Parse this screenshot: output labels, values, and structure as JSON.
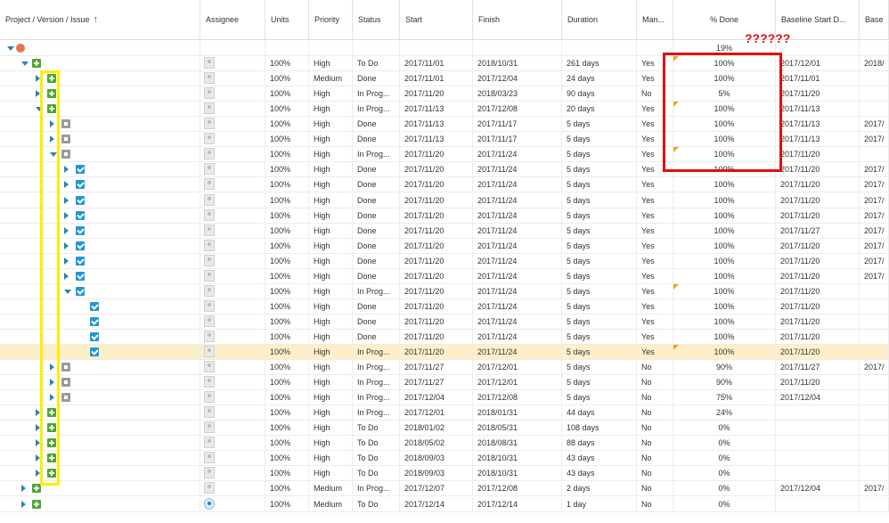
{
  "columns": [
    {
      "key": "tree",
      "label": "Project / Version / Issue"
    },
    {
      "key": "assignee",
      "label": "Assignee"
    },
    {
      "key": "units",
      "label": "Units"
    },
    {
      "key": "priority",
      "label": "Priority"
    },
    {
      "key": "status",
      "label": "Status"
    },
    {
      "key": "start",
      "label": "Start"
    },
    {
      "key": "finish",
      "label": "Finish"
    },
    {
      "key": "duration",
      "label": "Duration"
    },
    {
      "key": "manual",
      "label": "Man..."
    },
    {
      "key": "done",
      "label": "% Done"
    },
    {
      "key": "baseline_start",
      "label": "Baseline Start D..."
    },
    {
      "key": "baseline_more",
      "label": "Base"
    }
  ],
  "sort_icon": "↑",
  "annotation_text": "??????",
  "rows": [
    {
      "icon": "proj",
      "toggle": "d",
      "level": 0,
      "units": "",
      "priority": "",
      "status": "",
      "start": "",
      "finish": "",
      "duration": "",
      "manual": "",
      "done": "19%",
      "flag": false,
      "bstart": "",
      "bmore": "",
      "assignee": "none"
    },
    {
      "icon": "plus",
      "toggle": "d",
      "level": 1,
      "units": "100%",
      "priority": "High",
      "status": "To Do",
      "start": "2017/11/01",
      "finish": "2018/10/31",
      "duration": "261 days",
      "manual": "Yes",
      "done": "100%",
      "flag": true,
      "bstart": "2017/12/01",
      "bmore": "2018/",
      "assignee": "user"
    },
    {
      "icon": "plus",
      "toggle": "r",
      "level": 2,
      "units": "100%",
      "priority": "Medium",
      "status": "Done",
      "start": "2017/11/01",
      "finish": "2017/12/04",
      "duration": "24 days",
      "manual": "Yes",
      "done": "100%",
      "flag": false,
      "bstart": "2017/11/01",
      "bmore": "",
      "assignee": "user"
    },
    {
      "icon": "plus",
      "toggle": "r",
      "level": 2,
      "units": "100%",
      "priority": "High",
      "status": "In Prog...",
      "start": "2017/11/20",
      "finish": "2018/03/23",
      "duration": "90 days",
      "manual": "No",
      "done": "5%",
      "flag": false,
      "bstart": "2017/11/20",
      "bmore": "",
      "assignee": "user"
    },
    {
      "icon": "plus",
      "toggle": "d",
      "level": 2,
      "units": "100%",
      "priority": "High",
      "status": "In Prog...",
      "start": "2017/11/13",
      "finish": "2017/12/08",
      "duration": "20 days",
      "manual": "Yes",
      "done": "100%",
      "flag": true,
      "bstart": "2017/11/13",
      "bmore": "",
      "assignee": "user"
    },
    {
      "icon": "task",
      "toggle": "r",
      "level": 3,
      "units": "100%",
      "priority": "High",
      "status": "Done",
      "start": "2017/11/13",
      "finish": "2017/11/17",
      "duration": "5 days",
      "manual": "Yes",
      "done": "100%",
      "flag": false,
      "bstart": "2017/11/13",
      "bmore": "2017/",
      "assignee": "user"
    },
    {
      "icon": "task",
      "toggle": "r",
      "level": 3,
      "units": "100%",
      "priority": "High",
      "status": "Done",
      "start": "2017/11/13",
      "finish": "2017/11/17",
      "duration": "5 days",
      "manual": "Yes",
      "done": "100%",
      "flag": false,
      "bstart": "2017/11/13",
      "bmore": "2017/",
      "assignee": "user"
    },
    {
      "icon": "task",
      "toggle": "d",
      "level": 3,
      "units": "100%",
      "priority": "High",
      "status": "In Prog...",
      "start": "2017/11/20",
      "finish": "2017/11/24",
      "duration": "5 days",
      "manual": "Yes",
      "done": "100%",
      "flag": true,
      "bstart": "2017/11/20",
      "bmore": "",
      "assignee": "user"
    },
    {
      "icon": "check",
      "toggle": "r",
      "level": 4,
      "units": "100%",
      "priority": "High",
      "status": "Done",
      "start": "2017/11/20",
      "finish": "2017/11/24",
      "duration": "5 days",
      "manual": "Yes",
      "done": "100%",
      "flag": false,
      "bstart": "2017/11/20",
      "bmore": "2017/",
      "assignee": "user"
    },
    {
      "icon": "check",
      "toggle": "r",
      "level": 4,
      "units": "100%",
      "priority": "High",
      "status": "Done",
      "start": "2017/11/20",
      "finish": "2017/11/24",
      "duration": "5 days",
      "manual": "Yes",
      "done": "100%",
      "flag": false,
      "bstart": "2017/11/20",
      "bmore": "2017/",
      "assignee": "user"
    },
    {
      "icon": "check",
      "toggle": "r",
      "level": 4,
      "units": "100%",
      "priority": "High",
      "status": "Done",
      "start": "2017/11/20",
      "finish": "2017/11/24",
      "duration": "5 days",
      "manual": "Yes",
      "done": "100%",
      "flag": false,
      "bstart": "2017/11/20",
      "bmore": "2017/",
      "assignee": "user"
    },
    {
      "icon": "check",
      "toggle": "r",
      "level": 4,
      "units": "100%",
      "priority": "High",
      "status": "Done",
      "start": "2017/11/20",
      "finish": "2017/11/24",
      "duration": "5 days",
      "manual": "Yes",
      "done": "100%",
      "flag": false,
      "bstart": "2017/11/20",
      "bmore": "2017/",
      "assignee": "user"
    },
    {
      "icon": "check",
      "toggle": "r",
      "level": 4,
      "units": "100%",
      "priority": "High",
      "status": "Done",
      "start": "2017/11/20",
      "finish": "2017/11/24",
      "duration": "5 days",
      "manual": "Yes",
      "done": "100%",
      "flag": false,
      "bstart": "2017/11/27",
      "bmore": "2017/",
      "assignee": "user"
    },
    {
      "icon": "check",
      "toggle": "r",
      "level": 4,
      "units": "100%",
      "priority": "High",
      "status": "Done",
      "start": "2017/11/20",
      "finish": "2017/11/24",
      "duration": "5 days",
      "manual": "Yes",
      "done": "100%",
      "flag": false,
      "bstart": "2017/11/20",
      "bmore": "2017/",
      "assignee": "user"
    },
    {
      "icon": "check",
      "toggle": "r",
      "level": 4,
      "units": "100%",
      "priority": "High",
      "status": "Done",
      "start": "2017/11/20",
      "finish": "2017/11/24",
      "duration": "5 days",
      "manual": "Yes",
      "done": "100%",
      "flag": false,
      "bstart": "2017/11/20",
      "bmore": "2017/",
      "assignee": "user"
    },
    {
      "icon": "check",
      "toggle": "r",
      "level": 4,
      "units": "100%",
      "priority": "High",
      "status": "Done",
      "start": "2017/11/20",
      "finish": "2017/11/24",
      "duration": "5 days",
      "manual": "Yes",
      "done": "100%",
      "flag": false,
      "bstart": "2017/11/20",
      "bmore": "2017/",
      "assignee": "user"
    },
    {
      "icon": "check",
      "toggle": "d",
      "level": 4,
      "units": "100%",
      "priority": "High",
      "status": "In Prog...",
      "start": "2017/11/20",
      "finish": "2017/11/24",
      "duration": "5 days",
      "manual": "Yes",
      "done": "100%",
      "flag": true,
      "bstart": "2017/11/20",
      "bmore": "",
      "assignee": "user"
    },
    {
      "icon": "check",
      "toggle": "",
      "level": 5,
      "units": "100%",
      "priority": "High",
      "status": "Done",
      "start": "2017/11/20",
      "finish": "2017/11/24",
      "duration": "5 days",
      "manual": "Yes",
      "done": "100%",
      "flag": false,
      "bstart": "2017/11/20",
      "bmore": "",
      "assignee": "user"
    },
    {
      "icon": "check",
      "toggle": "",
      "level": 5,
      "units": "100%",
      "priority": "High",
      "status": "Done",
      "start": "2017/11/20",
      "finish": "2017/11/24",
      "duration": "5 days",
      "manual": "Yes",
      "done": "100%",
      "flag": false,
      "bstart": "2017/11/20",
      "bmore": "",
      "assignee": "user"
    },
    {
      "icon": "check",
      "toggle": "",
      "level": 5,
      "units": "100%",
      "priority": "High",
      "status": "Done",
      "start": "2017/11/20",
      "finish": "2017/11/24",
      "duration": "5 days",
      "manual": "Yes",
      "done": "100%",
      "flag": false,
      "bstart": "2017/11/20",
      "bmore": "",
      "assignee": "user"
    },
    {
      "icon": "check",
      "toggle": "",
      "level": 5,
      "units": "100%",
      "priority": "High",
      "status": "In Prog...",
      "start": "2017/11/20",
      "finish": "2017/11/24",
      "duration": "5 days",
      "manual": "Yes",
      "done": "100%",
      "flag": true,
      "bstart": "2017/11/20",
      "bmore": "",
      "assignee": "user",
      "selected": true
    },
    {
      "icon": "task",
      "toggle": "r",
      "level": 3,
      "units": "100%",
      "priority": "High",
      "status": "In Prog...",
      "start": "2017/11/27",
      "finish": "2017/12/01",
      "duration": "5 days",
      "manual": "No",
      "done": "90%",
      "flag": false,
      "bstart": "2017/11/27",
      "bmore": "2017/",
      "assignee": "user"
    },
    {
      "icon": "task",
      "toggle": "r",
      "level": 3,
      "units": "100%",
      "priority": "High",
      "status": "In Prog...",
      "start": "2017/11/27",
      "finish": "2017/12/01",
      "duration": "5 days",
      "manual": "No",
      "done": "90%",
      "flag": false,
      "bstart": "2017/11/20",
      "bmore": "",
      "assignee": "user"
    },
    {
      "icon": "task",
      "toggle": "r",
      "level": 3,
      "units": "100%",
      "priority": "High",
      "status": "In Prog...",
      "start": "2017/12/04",
      "finish": "2017/12/08",
      "duration": "5 days",
      "manual": "No",
      "done": "75%",
      "flag": false,
      "bstart": "2017/12/04",
      "bmore": "",
      "assignee": "user"
    },
    {
      "icon": "plus",
      "toggle": "r",
      "level": 2,
      "units": "100%",
      "priority": "High",
      "status": "In Prog...",
      "start": "2017/12/01",
      "finish": "2018/01/31",
      "duration": "44 days",
      "manual": "No",
      "done": "24%",
      "flag": false,
      "bstart": "",
      "bmore": "",
      "assignee": "user"
    },
    {
      "icon": "plus",
      "toggle": "r",
      "level": 2,
      "units": "100%",
      "priority": "High",
      "status": "To Do",
      "start": "2018/01/02",
      "finish": "2018/05/31",
      "duration": "108 days",
      "manual": "No",
      "done": "0%",
      "flag": false,
      "bstart": "",
      "bmore": "",
      "assignee": "user"
    },
    {
      "icon": "plus",
      "toggle": "r",
      "level": 2,
      "units": "100%",
      "priority": "High",
      "status": "To Do",
      "start": "2018/05/02",
      "finish": "2018/08/31",
      "duration": "88 days",
      "manual": "No",
      "done": "0%",
      "flag": false,
      "bstart": "",
      "bmore": "",
      "assignee": "user"
    },
    {
      "icon": "plus",
      "toggle": "r",
      "level": 2,
      "units": "100%",
      "priority": "High",
      "status": "To Do",
      "start": "2018/09/03",
      "finish": "2018/10/31",
      "duration": "43 days",
      "manual": "No",
      "done": "0%",
      "flag": false,
      "bstart": "",
      "bmore": "",
      "assignee": "user"
    },
    {
      "icon": "plus",
      "toggle": "r",
      "level": 2,
      "units": "100%",
      "priority": "High",
      "status": "To Do",
      "start": "2018/09/03",
      "finish": "2018/10/31",
      "duration": "43 days",
      "manual": "No",
      "done": "0%",
      "flag": false,
      "bstart": "",
      "bmore": "",
      "assignee": "user"
    },
    {
      "icon": "plus",
      "toggle": "r",
      "level": 1,
      "units": "100%",
      "priority": "Medium",
      "status": "In Prog...",
      "start": "2017/12/07",
      "finish": "2017/12/08",
      "duration": "2 days",
      "manual": "No",
      "done": "0%",
      "flag": false,
      "bstart": "2017/12/04",
      "bmore": "2017/",
      "assignee": "user"
    },
    {
      "icon": "plus",
      "toggle": "r",
      "level": 1,
      "units": "100%",
      "priority": "Medium",
      "status": "To Do",
      "start": "2017/12/14",
      "finish": "2017/12/14",
      "duration": "1 day",
      "manual": "No",
      "done": "0%",
      "flag": false,
      "bstart": "",
      "bmore": "",
      "assignee": "globe"
    }
  ]
}
